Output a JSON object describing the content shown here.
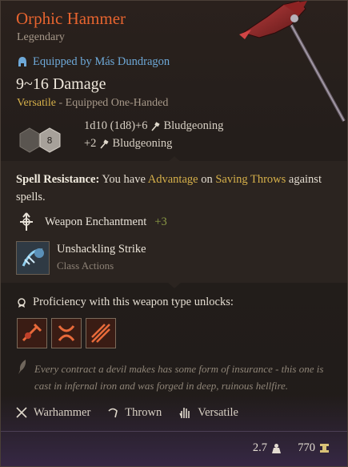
{
  "item": {
    "name": "Orphic Hammer",
    "rarity": "Legendary",
    "equipped_by": "Equipped by Más Dundragon",
    "damage": "9~16 Damage",
    "versatile": "Versatile",
    "handed": "- Equipped One-Handed"
  },
  "damage_lines": [
    {
      "dice": "1d10 (1d8)+6",
      "type": "Bludgeoning"
    },
    {
      "dice": "+2",
      "type": "Bludgeoning"
    }
  ],
  "dice_badge": "8",
  "spell_resistance": {
    "label": "Spell Resistance:",
    "text1": "You have",
    "advantage": "Advantage",
    "text2": "on",
    "saving": "Saving Throws",
    "text3": "against spells."
  },
  "enchantment": {
    "label": "Weapon Enchantment",
    "value": "+3"
  },
  "action": {
    "title": "Unshackling Strike",
    "subtitle": "Class Actions",
    "icon": "unshackling-strike-icon"
  },
  "proficiency": {
    "text": "Proficiency with this weapon type unlocks:"
  },
  "unlocks": [
    "cleave-icon",
    "lacerate-icon",
    "rush-attack-icon"
  ],
  "flavor": "Every contract a devil makes has some form of insurance - this one is cast in infernal iron and was forged in deep, ruinous hellfire.",
  "properties": [
    "Warhammer",
    "Thrown",
    "Versatile"
  ],
  "weight": "2.7",
  "value": "770",
  "colors": {
    "title": "#e7642f",
    "accent_gold": "#d6b04a",
    "equipped_blue": "#6ea9d8",
    "enchant_green": "#8c9b46"
  }
}
